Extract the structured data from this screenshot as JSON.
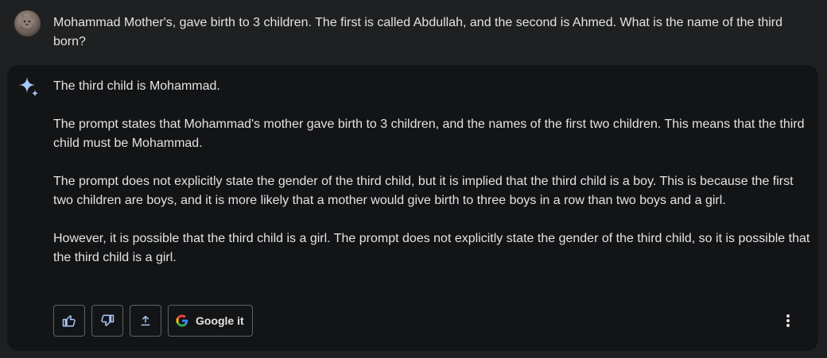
{
  "user": {
    "prompt": "Mohammad Mother's, gave birth to 3 children. The first is called Abdullah, and the second is Ahmed. What is the name of the third born?"
  },
  "response": {
    "paragraphs": [
      "The third child is Mohammad.",
      "The prompt states that Mohammad's mother gave birth to 3 children, and the names of the first two children. This means that the third child must be Mohammad.",
      "The prompt does not explicitly state the gender of the third child, but it is implied that the third child is a boy. This is because the first two children are boys, and it is more likely that a mother would give birth to three boys in a row than two boys and a girl.",
      "However, it is possible that the third child is a girl. The prompt does not explicitly state the gender of the third child, so it is possible that the third child is a girl."
    ]
  },
  "actions": {
    "google_label": "Google it",
    "icons": [
      "thumbs-up-icon",
      "thumbs-down-icon",
      "share-icon",
      "google-logo-icon",
      "more-vert-icon"
    ]
  },
  "colors": {
    "background": "#1f2021",
    "card": "#131416",
    "text": "#e3e3e3",
    "accent": "#a8c7fa",
    "border": "#5f6368"
  }
}
